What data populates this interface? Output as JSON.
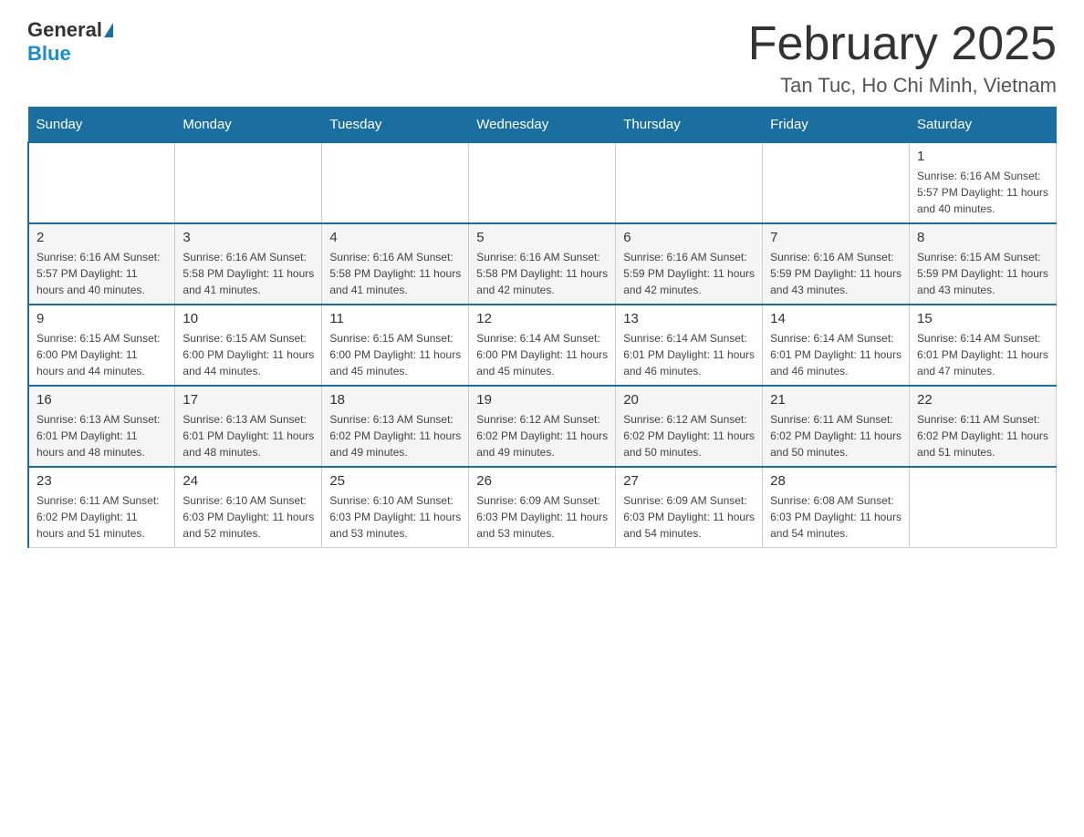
{
  "header": {
    "logo_general": "General",
    "logo_blue": "Blue",
    "month_title": "February 2025",
    "location": "Tan Tuc, Ho Chi Minh, Vietnam"
  },
  "days_of_week": [
    "Sunday",
    "Monday",
    "Tuesday",
    "Wednesday",
    "Thursday",
    "Friday",
    "Saturday"
  ],
  "weeks": [
    [
      {
        "day": "",
        "info": ""
      },
      {
        "day": "",
        "info": ""
      },
      {
        "day": "",
        "info": ""
      },
      {
        "day": "",
        "info": ""
      },
      {
        "day": "",
        "info": ""
      },
      {
        "day": "",
        "info": ""
      },
      {
        "day": "1",
        "info": "Sunrise: 6:16 AM\nSunset: 5:57 PM\nDaylight: 11 hours\nand 40 minutes."
      }
    ],
    [
      {
        "day": "2",
        "info": "Sunrise: 6:16 AM\nSunset: 5:57 PM\nDaylight: 11 hours\nand 40 minutes."
      },
      {
        "day": "3",
        "info": "Sunrise: 6:16 AM\nSunset: 5:58 PM\nDaylight: 11 hours\nand 41 minutes."
      },
      {
        "day": "4",
        "info": "Sunrise: 6:16 AM\nSunset: 5:58 PM\nDaylight: 11 hours\nand 41 minutes."
      },
      {
        "day": "5",
        "info": "Sunrise: 6:16 AM\nSunset: 5:58 PM\nDaylight: 11 hours\nand 42 minutes."
      },
      {
        "day": "6",
        "info": "Sunrise: 6:16 AM\nSunset: 5:59 PM\nDaylight: 11 hours\nand 42 minutes."
      },
      {
        "day": "7",
        "info": "Sunrise: 6:16 AM\nSunset: 5:59 PM\nDaylight: 11 hours\nand 43 minutes."
      },
      {
        "day": "8",
        "info": "Sunrise: 6:15 AM\nSunset: 5:59 PM\nDaylight: 11 hours\nand 43 minutes."
      }
    ],
    [
      {
        "day": "9",
        "info": "Sunrise: 6:15 AM\nSunset: 6:00 PM\nDaylight: 11 hours\nand 44 minutes."
      },
      {
        "day": "10",
        "info": "Sunrise: 6:15 AM\nSunset: 6:00 PM\nDaylight: 11 hours\nand 44 minutes."
      },
      {
        "day": "11",
        "info": "Sunrise: 6:15 AM\nSunset: 6:00 PM\nDaylight: 11 hours\nand 45 minutes."
      },
      {
        "day": "12",
        "info": "Sunrise: 6:14 AM\nSunset: 6:00 PM\nDaylight: 11 hours\nand 45 minutes."
      },
      {
        "day": "13",
        "info": "Sunrise: 6:14 AM\nSunset: 6:01 PM\nDaylight: 11 hours\nand 46 minutes."
      },
      {
        "day": "14",
        "info": "Sunrise: 6:14 AM\nSunset: 6:01 PM\nDaylight: 11 hours\nand 46 minutes."
      },
      {
        "day": "15",
        "info": "Sunrise: 6:14 AM\nSunset: 6:01 PM\nDaylight: 11 hours\nand 47 minutes."
      }
    ],
    [
      {
        "day": "16",
        "info": "Sunrise: 6:13 AM\nSunset: 6:01 PM\nDaylight: 11 hours\nand 48 minutes."
      },
      {
        "day": "17",
        "info": "Sunrise: 6:13 AM\nSunset: 6:01 PM\nDaylight: 11 hours\nand 48 minutes."
      },
      {
        "day": "18",
        "info": "Sunrise: 6:13 AM\nSunset: 6:02 PM\nDaylight: 11 hours\nand 49 minutes."
      },
      {
        "day": "19",
        "info": "Sunrise: 6:12 AM\nSunset: 6:02 PM\nDaylight: 11 hours\nand 49 minutes."
      },
      {
        "day": "20",
        "info": "Sunrise: 6:12 AM\nSunset: 6:02 PM\nDaylight: 11 hours\nand 50 minutes."
      },
      {
        "day": "21",
        "info": "Sunrise: 6:11 AM\nSunset: 6:02 PM\nDaylight: 11 hours\nand 50 minutes."
      },
      {
        "day": "22",
        "info": "Sunrise: 6:11 AM\nSunset: 6:02 PM\nDaylight: 11 hours\nand 51 minutes."
      }
    ],
    [
      {
        "day": "23",
        "info": "Sunrise: 6:11 AM\nSunset: 6:02 PM\nDaylight: 11 hours\nand 51 minutes."
      },
      {
        "day": "24",
        "info": "Sunrise: 6:10 AM\nSunset: 6:03 PM\nDaylight: 11 hours\nand 52 minutes."
      },
      {
        "day": "25",
        "info": "Sunrise: 6:10 AM\nSunset: 6:03 PM\nDaylight: 11 hours\nand 53 minutes."
      },
      {
        "day": "26",
        "info": "Sunrise: 6:09 AM\nSunset: 6:03 PM\nDaylight: 11 hours\nand 53 minutes."
      },
      {
        "day": "27",
        "info": "Sunrise: 6:09 AM\nSunset: 6:03 PM\nDaylight: 11 hours\nand 54 minutes."
      },
      {
        "day": "28",
        "info": "Sunrise: 6:08 AM\nSunset: 6:03 PM\nDaylight: 11 hours\nand 54 minutes."
      },
      {
        "day": "",
        "info": ""
      }
    ]
  ]
}
